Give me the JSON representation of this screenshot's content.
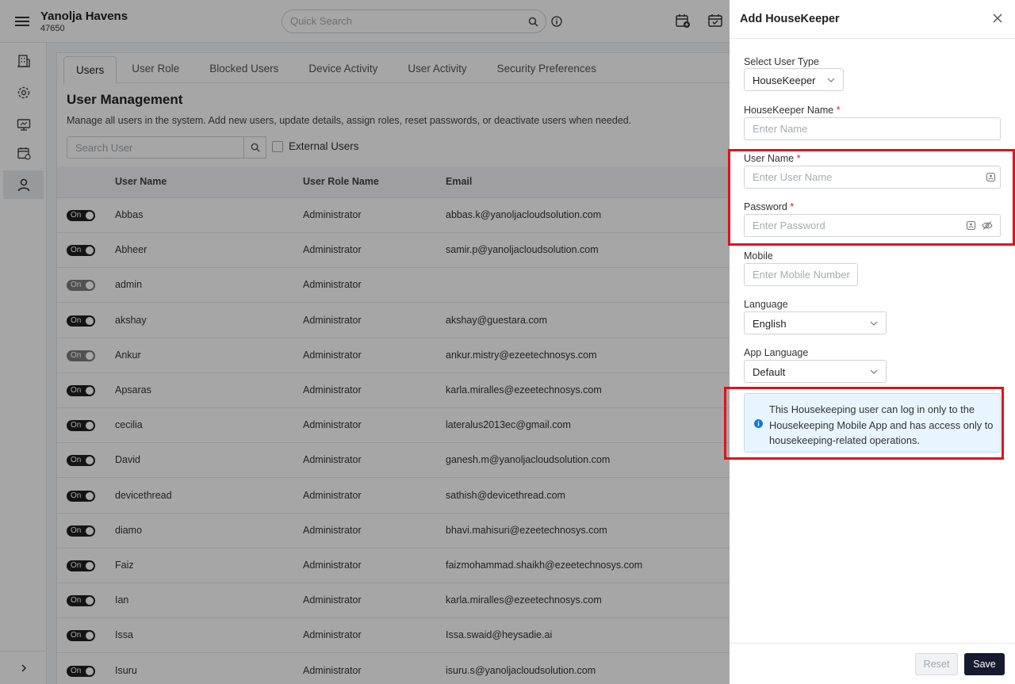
{
  "header": {
    "property_name": "Yanolja Havens",
    "property_id": "47650",
    "search_placeholder": "Quick Search"
  },
  "tabs": [
    {
      "label": "Users",
      "active": true
    },
    {
      "label": "User Role"
    },
    {
      "label": "Blocked Users"
    },
    {
      "label": "Device Activity"
    },
    {
      "label": "User Activity"
    },
    {
      "label": "Security Preferences"
    }
  ],
  "page": {
    "title": "User Management",
    "description": "Manage all users in the system. Add new users, update details, assign roles, reset passwords, or deactivate users when needed.",
    "search_placeholder": "Search User",
    "external_users_label": "External Users"
  },
  "table": {
    "columns": [
      "User Name",
      "User Role Name",
      "Email"
    ],
    "rows": [
      {
        "toggle": "On",
        "name": "Abbas",
        "role": "Administrator",
        "email": "abbas.k@yanoljacloudsolution.com"
      },
      {
        "toggle": "On",
        "name": "Abheer",
        "role": "Administrator",
        "email": "samir.p@yanoljacloudsolution.com"
      },
      {
        "toggle": "On",
        "name": "admin",
        "role": "Administrator",
        "email": "",
        "dim": true
      },
      {
        "toggle": "On",
        "name": "akshay",
        "role": "Administrator",
        "email": "akshay@guestara.com"
      },
      {
        "toggle": "On",
        "name": "Ankur",
        "role": "Administrator",
        "email": "ankur.mistry@ezeetechnosys.com",
        "dim": true
      },
      {
        "toggle": "On",
        "name": "Apsaras",
        "role": "Administrator",
        "email": "karla.miralles@ezeetechnosys.com"
      },
      {
        "toggle": "On",
        "name": "cecilia",
        "role": "Administrator",
        "email": "lateralus2013ec@gmail.com"
      },
      {
        "toggle": "On",
        "name": "David",
        "role": "Administrator",
        "email": "ganesh.m@yanoljacloudsolution.com"
      },
      {
        "toggle": "On",
        "name": "devicethread",
        "role": "Administrator",
        "email": "sathish@devicethread.com"
      },
      {
        "toggle": "On",
        "name": "diamo",
        "role": "Administrator",
        "email": "bhavi.mahisuri@ezeetechnosys.com"
      },
      {
        "toggle": "On",
        "name": "Faiz",
        "role": "Administrator",
        "email": "faizmohammad.shaikh@ezeetechnosys.com"
      },
      {
        "toggle": "On",
        "name": "Ian",
        "role": "Administrator",
        "email": "karla.miralles@ezeetechnosys.com"
      },
      {
        "toggle": "On",
        "name": "Issa",
        "role": "Administrator",
        "email": "Issa.swaid@heysadie.ai"
      },
      {
        "toggle": "On",
        "name": "Isuru",
        "role": "Administrator",
        "email": "isuru.s@yanoljacloudsolution.com"
      }
    ]
  },
  "drawer": {
    "title": "Add HouseKeeper",
    "user_type_label": "Select User Type",
    "user_type_value": "HouseKeeper",
    "hk_name_label": "HouseKeeper Name",
    "hk_name_placeholder": "Enter Name",
    "username_label": "User Name",
    "username_placeholder": "Enter User Name",
    "password_label": "Password",
    "password_placeholder": "Enter Password",
    "mobile_label": "Mobile",
    "mobile_placeholder": "Enter Mobile Number",
    "language_label": "Language",
    "language_value": "English",
    "app_language_label": "App Language",
    "app_language_value": "Default",
    "required_mark": "*",
    "info_text": "This Housekeeping user can log in only to the Housekeeping Mobile App and has access only to housekeeping-related operations.",
    "reset_label": "Reset",
    "save_label": "Save"
  },
  "colors": {
    "highlight": "#e1121b",
    "info_bg": "#e7f5fe",
    "save_bg": "#151a2e"
  }
}
